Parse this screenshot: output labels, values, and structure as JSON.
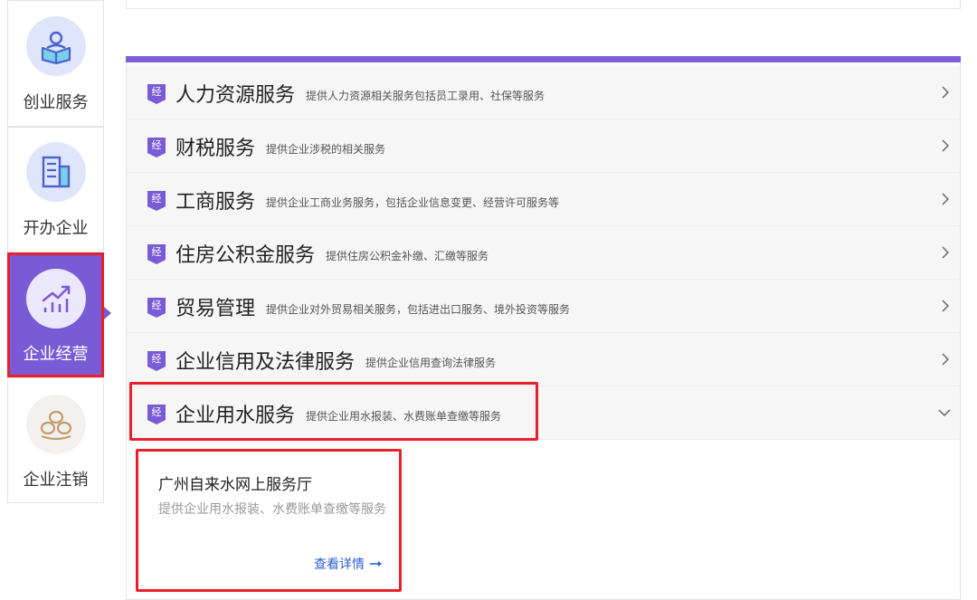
{
  "sidebar": {
    "items": [
      {
        "label": "创业服务",
        "icon": "person-reading-book-icon"
      },
      {
        "label": "开办企业",
        "icon": "office-building-icon"
      },
      {
        "label": "企业经营",
        "icon": "growth-chart-icon",
        "active": true
      },
      {
        "label": "企业注销",
        "icon": "stacked-coins-icon"
      }
    ]
  },
  "main": {
    "badge_label": "经",
    "services": [
      {
        "title": "人力资源服务",
        "desc": "提供人力资源相关服务包括员工录用、社保等服务",
        "expanded": false
      },
      {
        "title": "财税服务",
        "desc": "提供企业涉税的相关服务",
        "expanded": false
      },
      {
        "title": "工商服务",
        "desc": "提供企业工商业务服务，包括企业信息变更、经营许可服务等",
        "expanded": false
      },
      {
        "title": "住房公积金服务",
        "desc": "提供住房公积金补缴、汇缴等服务",
        "expanded": false
      },
      {
        "title": "贸易管理",
        "desc": "提供企业对外贸易相关服务，包括进出口服务、境外投资等服务",
        "expanded": false
      },
      {
        "title": "企业信用及法律服务",
        "desc": "提供企业信用查询法律服务",
        "expanded": false
      },
      {
        "title": "企业用水服务",
        "desc": "提供企业用水报装、水费账单查缴等服务",
        "expanded": true
      }
    ],
    "sub_card": {
      "title": "广州自来水网上服务厅",
      "desc": "提供企业用水报装、水费账单查缴等服务",
      "link": "查看详情"
    }
  },
  "colors": {
    "accent": "#7a5bd6",
    "highlight": "#e8202a",
    "link": "#2a5fd6"
  }
}
